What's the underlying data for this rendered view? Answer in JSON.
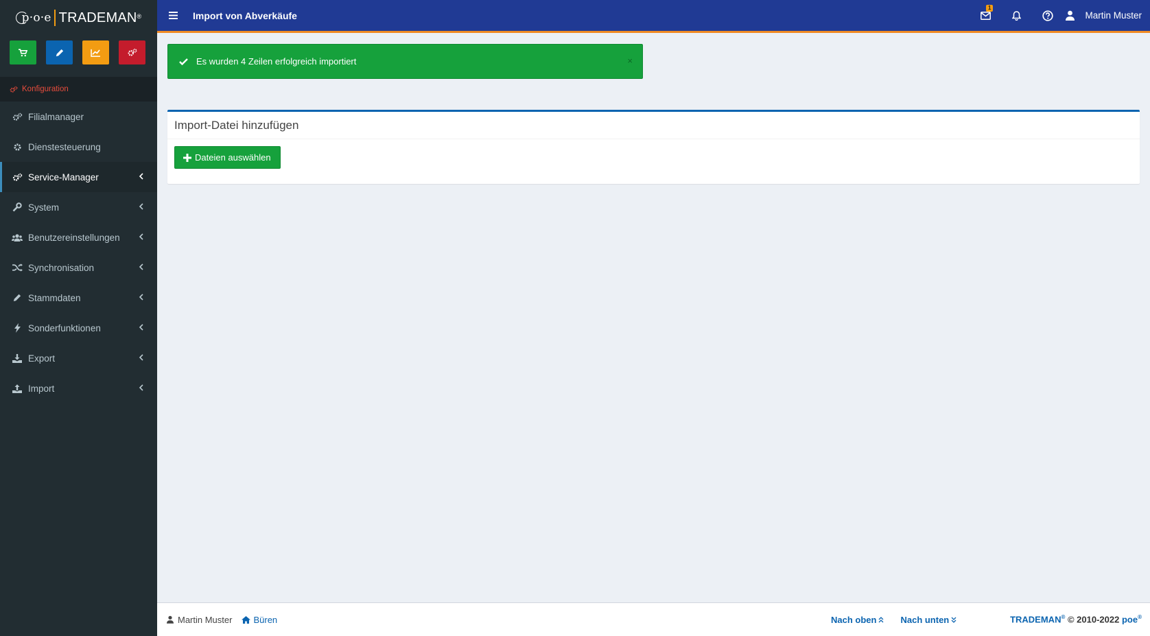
{
  "app": {
    "logo_poe": "p·o·e",
    "logo_trademan": "TRADEMAN",
    "logo_reg": "®"
  },
  "sidebar": {
    "section": "Konfiguration",
    "items": [
      {
        "label": "Filialmanager",
        "icon": "cogs-icon",
        "has_children": false,
        "active": false
      },
      {
        "label": "Dienstesteuerung",
        "icon": "cog-icon",
        "has_children": false,
        "active": false
      },
      {
        "label": "Service-Manager",
        "icon": "cogs-icon",
        "has_children": true,
        "active": true
      },
      {
        "label": "System",
        "icon": "wrench-icon",
        "has_children": true,
        "active": false
      },
      {
        "label": "Benutzereinstellungen",
        "icon": "users-icon",
        "has_children": true,
        "active": false
      },
      {
        "label": "Synchronisation",
        "icon": "shuffle-icon",
        "has_children": true,
        "active": false
      },
      {
        "label": "Stammdaten",
        "icon": "pencil-icon",
        "has_children": true,
        "active": false
      },
      {
        "label": "Sonderfunktionen",
        "icon": "bolt-icon",
        "has_children": true,
        "active": false
      },
      {
        "label": "Export",
        "icon": "download-icon",
        "has_children": true,
        "active": false
      },
      {
        "label": "Import",
        "icon": "upload-icon",
        "has_children": true,
        "active": false
      }
    ],
    "quick_buttons": [
      {
        "icon": "cart-icon",
        "color": "#16a13c"
      },
      {
        "icon": "pencil-icon",
        "color": "#0b64b0"
      },
      {
        "icon": "chart-icon",
        "color": "#f39c12"
      },
      {
        "icon": "cogs-icon",
        "color": "#c41c2c"
      }
    ]
  },
  "header": {
    "title": "Import von Abverkäufe",
    "mail_badge": "1",
    "user_name": "Martin Muster"
  },
  "alert": {
    "message": "Es wurden 4 Zeilen erfolgreich importiert",
    "close": "×"
  },
  "box": {
    "title": "Import-Datei hinzufügen",
    "button_label": "Dateien auswählen"
  },
  "footer": {
    "user": "Martin Muster",
    "location": "Büren",
    "to_top": "Nach oben",
    "to_bottom": "Nach unten",
    "brand": "TRADEMAN",
    "copyright": " © 2010-2022 ",
    "company": "poe",
    "reg": "®"
  },
  "colors": {
    "header_bg": "#203a94",
    "accent_orange": "#f08a24",
    "sidebar_bg": "#222d32",
    "success": "#16a13c",
    "primary": "#0b64b0"
  }
}
